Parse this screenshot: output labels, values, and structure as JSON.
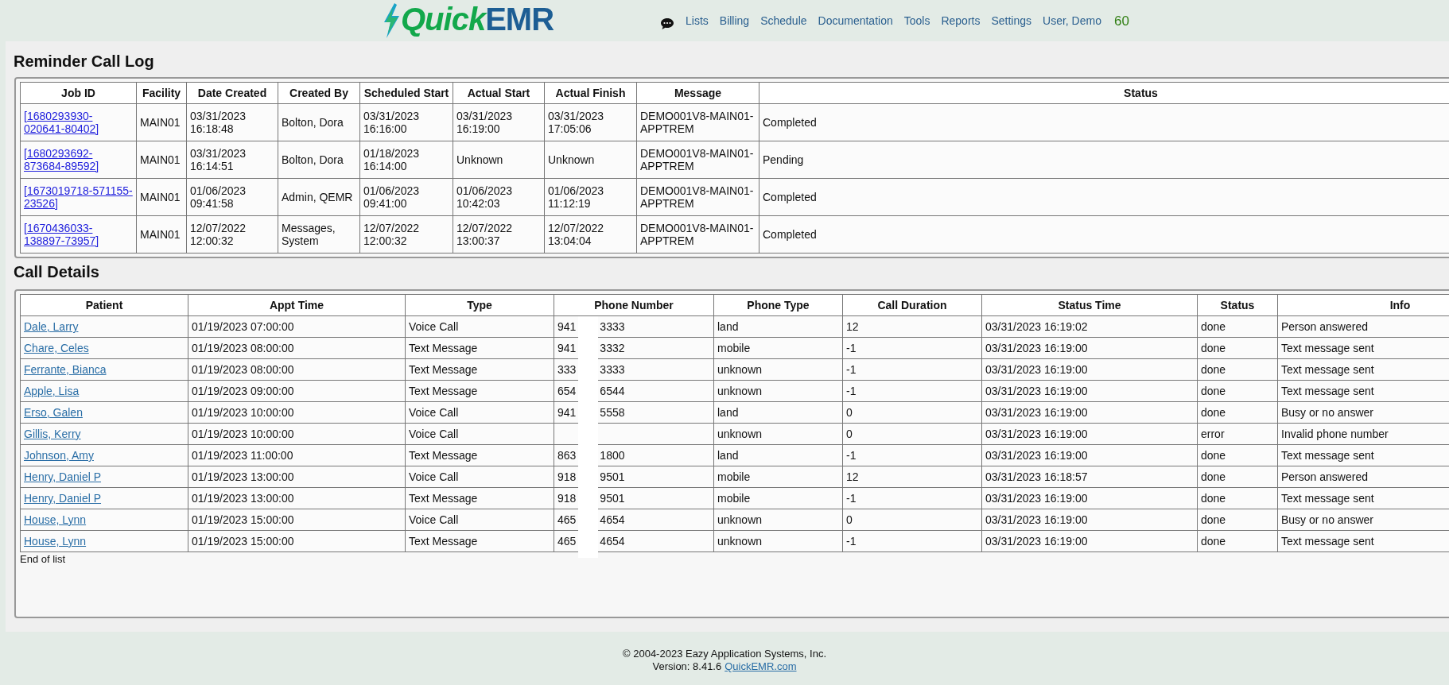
{
  "header": {
    "logo": {
      "part1": "Quick",
      "part2": "EMR"
    },
    "nav": [
      "Lists",
      "Billing",
      "Schedule",
      "Documentation",
      "Tools",
      "Reports",
      "Settings",
      "User, Demo"
    ],
    "counter": "60"
  },
  "reminder_call_log": {
    "title": "Reminder Call Log",
    "columns": [
      "Job ID",
      "Facility",
      "Date Created",
      "Created By",
      "Scheduled Start",
      "Actual Start",
      "Actual Finish",
      "Message",
      "Status"
    ],
    "rows": [
      {
        "job_id": "[1680293930-020641-80402]",
        "facility": "MAIN01",
        "date_created": "03/31/2023 16:18:48",
        "created_by": "Bolton, Dora",
        "scheduled_start": "03/31/2023 16:16:00",
        "actual_start": "03/31/2023 16:19:00",
        "actual_finish": "03/31/2023 17:05:06",
        "message": "DEMO001V8-MAIN01-APPTREM",
        "status": "Completed"
      },
      {
        "job_id": "[1680293692-873684-89592]",
        "facility": "MAIN01",
        "date_created": "03/31/2023 16:14:51",
        "created_by": "Bolton, Dora",
        "scheduled_start": "01/18/2023 16:14:00",
        "actual_start": "Unknown",
        "actual_finish": "Unknown",
        "message": "DEMO001V8-MAIN01-APPTREM",
        "status": "Pending"
      },
      {
        "job_id": "[1673019718-571155-23526]",
        "facility": "MAIN01",
        "date_created": "01/06/2023 09:41:58",
        "created_by": "Admin, QEMR",
        "scheduled_start": "01/06/2023 09:41:00",
        "actual_start": "01/06/2023 10:42:03",
        "actual_finish": "01/06/2023 11:12:19",
        "message": "DEMO001V8-MAIN01-APPTREM",
        "status": "Completed"
      },
      {
        "job_id": "[1670436033-138897-73957]",
        "facility": "MAIN01",
        "date_created": "12/07/2022 12:00:32",
        "created_by": "Messages, System",
        "scheduled_start": "12/07/2022 12:00:32",
        "actual_start": "12/07/2022 13:00:37",
        "actual_finish": "12/07/2022 13:04:04",
        "message": "DEMO001V8-MAIN01-APPTREM",
        "status": "Completed"
      }
    ]
  },
  "call_details": {
    "title": "Call Details",
    "columns": [
      "Patient",
      "Appt Time",
      "Type",
      "Phone Number",
      "Phone Type",
      "Call Duration",
      "Status Time",
      "Status",
      "Info"
    ],
    "rows": [
      {
        "patient": "Dale, Larry",
        "appt_time": "01/19/2023 07:00:00",
        "type": "Voice Call",
        "phone_start": "941",
        "phone_end": "3333",
        "phone_type": "land",
        "call_duration": "12",
        "status_time": "03/31/2023 16:19:02",
        "status": "done",
        "info": "Person answered"
      },
      {
        "patient": "Chare, Celes",
        "appt_time": "01/19/2023 08:00:00",
        "type": "Text Message",
        "phone_start": "941",
        "phone_end": "3332",
        "phone_type": "mobile",
        "call_duration": "-1",
        "status_time": "03/31/2023 16:19:00",
        "status": "done",
        "info": "Text message sent"
      },
      {
        "patient": "Ferrante, Bianca",
        "appt_time": "01/19/2023 08:00:00",
        "type": "Text Message",
        "phone_start": "333",
        "phone_end": "3333",
        "phone_type": "unknown",
        "call_duration": "-1",
        "status_time": "03/31/2023 16:19:00",
        "status": "done",
        "info": "Text message sent"
      },
      {
        "patient": "Apple, Lisa",
        "appt_time": "01/19/2023 09:00:00",
        "type": "Text Message",
        "phone_start": "654",
        "phone_end": "6544",
        "phone_type": "unknown",
        "call_duration": "-1",
        "status_time": "03/31/2023 16:19:00",
        "status": "done",
        "info": "Text message sent"
      },
      {
        "patient": "Erso, Galen",
        "appt_time": "01/19/2023 10:00:00",
        "type": "Voice Call",
        "phone_start": "941",
        "phone_end": "5558",
        "phone_type": "land",
        "call_duration": "0",
        "status_time": "03/31/2023 16:19:00",
        "status": "done",
        "info": "Busy or no answer"
      },
      {
        "patient": "Gillis, Kerry",
        "appt_time": "01/19/2023 10:00:00",
        "type": "Voice Call",
        "phone_type": "unknown",
        "call_duration": "0",
        "status_time": "03/31/2023 16:19:00",
        "status": "error",
        "info": "Invalid phone number"
      },
      {
        "patient": "Johnson, Amy",
        "appt_time": "01/19/2023 11:00:00",
        "type": "Text Message",
        "phone_start": "863",
        "phone_end": "1800",
        "phone_type": "land",
        "call_duration": "-1",
        "status_time": "03/31/2023 16:19:00",
        "status": "done",
        "info": "Text message sent"
      },
      {
        "patient": "Henry, Daniel P",
        "appt_time": "01/19/2023 13:00:00",
        "type": "Voice Call",
        "phone_start": "918",
        "phone_end": "9501",
        "phone_type": "mobile",
        "call_duration": "12",
        "status_time": "03/31/2023 16:18:57",
        "status": "done",
        "info": "Person answered"
      },
      {
        "patient": "Henry, Daniel P",
        "appt_time": "01/19/2023 13:00:00",
        "type": "Text Message",
        "phone_start": "918",
        "phone_end": "9501",
        "phone_type": "mobile",
        "call_duration": "-1",
        "status_time": "03/31/2023 16:19:00",
        "status": "done",
        "info": "Text message sent"
      },
      {
        "patient": "House, Lynn",
        "appt_time": "01/19/2023 15:00:00",
        "type": "Voice Call",
        "phone_start": "465",
        "phone_end": "4654",
        "phone_type": "unknown",
        "call_duration": "0",
        "status_time": "03/31/2023 16:19:00",
        "status": "done",
        "info": "Busy or no answer"
      },
      {
        "patient": "House, Lynn",
        "appt_time": "01/19/2023 15:00:00",
        "type": "Text Message",
        "phone_start": "465",
        "phone_end": "4654",
        "phone_type": "unknown",
        "call_duration": "-1",
        "status_time": "03/31/2023 16:19:00",
        "status": "done",
        "info": "Text message sent"
      }
    ],
    "end_note": "End of list"
  },
  "footer": {
    "copyright": "© 2004-2023 Eazy Application Systems, Inc.",
    "version": "Version: 8.41.6",
    "link": "QuickEMR.com"
  }
}
